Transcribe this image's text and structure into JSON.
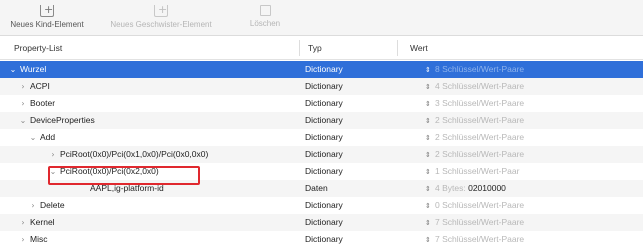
{
  "toolbar": {
    "buttons": [
      {
        "label": "Neues Kind-Element",
        "icon": "add-child-icon",
        "enabled": true
      },
      {
        "label": "Neues Geschwister-Element",
        "icon": "add-sibling-icon",
        "enabled": false
      },
      {
        "label": "Löschen",
        "icon": "trash-icon",
        "enabled": false
      }
    ]
  },
  "columns": {
    "key": "Property-List",
    "type": "Typ",
    "value": "Wert"
  },
  "rows": [
    {
      "disclosure": "⌄",
      "key": "Wurzel",
      "type": "Dictionary",
      "value": "8 Schlüssel/Wert-Paare",
      "selected": true
    },
    {
      "disclosure": "›",
      "key": "ACPI",
      "type": "Dictionary",
      "value": "4 Schlüssel/Wert-Paare"
    },
    {
      "disclosure": "›",
      "key": "Booter",
      "type": "Dictionary",
      "value": "3 Schlüssel/Wert-Paare"
    },
    {
      "disclosure": "⌄",
      "key": "DeviceProperties",
      "type": "Dictionary",
      "value": "2 Schlüssel/Wert-Paare"
    },
    {
      "disclosure": "⌄",
      "key": "Add",
      "type": "Dictionary",
      "value": "2 Schlüssel/Wert-Paare"
    },
    {
      "disclosure": "›",
      "key": "PciRoot(0x0)/Pci(0x1,0x0)/Pci(0x0,0x0)",
      "type": "Dictionary",
      "value": "2 Schlüssel/Wert-Paare"
    },
    {
      "disclosure": "⌄",
      "key": "PciRoot(0x0)/Pci(0x2,0x0)",
      "type": "Dictionary",
      "value": "1 Schlüssel/Wert-Paar",
      "highlighted": true
    },
    {
      "disclosure": "",
      "key": "AAPL,ig-platform-id",
      "type": "Daten",
      "value_prefix": "4 Bytes:",
      "value": "02010000",
      "data": true
    },
    {
      "disclosure": "›",
      "key": "Delete",
      "type": "Dictionary",
      "value": "0 Schlüssel/Wert-Paare"
    },
    {
      "disclosure": "›",
      "key": "Kernel",
      "type": "Dictionary",
      "value": "7 Schlüssel/Wert-Paare"
    },
    {
      "disclosure": "›",
      "key": "Misc",
      "type": "Dictionary",
      "value": "7 Schlüssel/Wert-Paare"
    }
  ],
  "colors": {
    "selection": "#2f6fd9",
    "highlight_box": "#e0282e"
  }
}
